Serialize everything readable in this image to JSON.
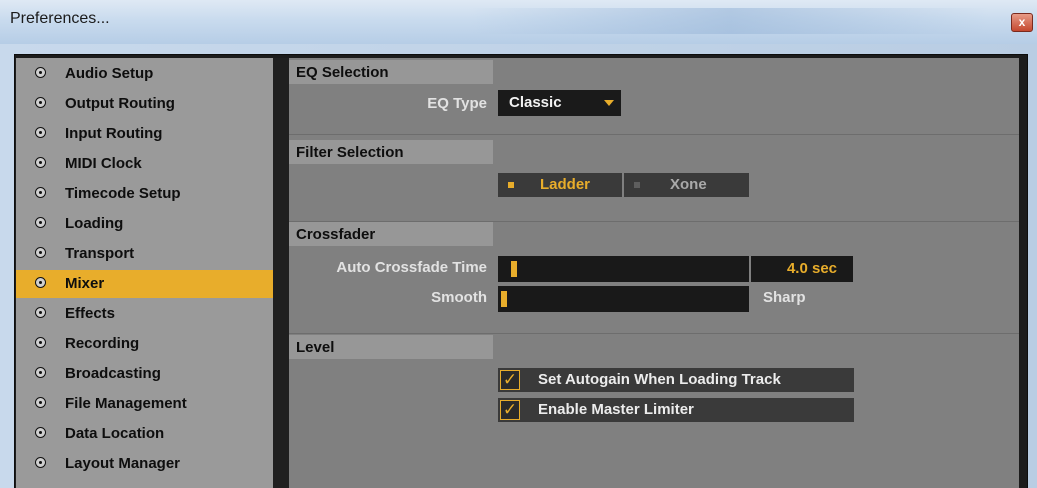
{
  "window": {
    "title": "Preferences...",
    "close_glyph": "x"
  },
  "sidebar": {
    "items": [
      {
        "label": "Audio Setup",
        "selected": false
      },
      {
        "label": "Output Routing",
        "selected": false
      },
      {
        "label": "Input Routing",
        "selected": false
      },
      {
        "label": "MIDI Clock",
        "selected": false
      },
      {
        "label": "Timecode Setup",
        "selected": false
      },
      {
        "label": "Loading",
        "selected": false
      },
      {
        "label": "Transport",
        "selected": false
      },
      {
        "label": "Mixer",
        "selected": true
      },
      {
        "label": "Effects",
        "selected": false
      },
      {
        "label": "Recording",
        "selected": false
      },
      {
        "label": "Broadcasting",
        "selected": false
      },
      {
        "label": "File Management",
        "selected": false
      },
      {
        "label": "Data Location",
        "selected": false
      },
      {
        "label": "Layout Manager",
        "selected": false
      }
    ]
  },
  "eq": {
    "section_title": "EQ Selection",
    "label": "EQ Type",
    "value": "Classic"
  },
  "filter": {
    "section_title": "Filter Selection",
    "options": [
      "Ladder",
      "Xone"
    ],
    "selected": "Ladder"
  },
  "crossfader": {
    "section_title": "Crossfader",
    "auto_label": "Auto Crossfade Time",
    "auto_value": "4.0 sec",
    "auto_fraction": 0.0,
    "curve_left_label": "Smooth",
    "curve_right_label": "Sharp",
    "curve_fraction": 0.0
  },
  "level": {
    "section_title": "Level",
    "autogain_label": "Set Autogain When Loading Track",
    "autogain_checked": true,
    "limiter_label": "Enable Master Limiter",
    "limiter_checked": true
  },
  "colors": {
    "accent": "#e8ad2b",
    "panel": "#808080",
    "sidebar": "#9a9a9a",
    "control": "#1a1a1a"
  },
  "icons": {
    "radio": "radio-bullet-icon",
    "dropdown": "triangle-down-icon",
    "check": "checkmark-icon"
  }
}
